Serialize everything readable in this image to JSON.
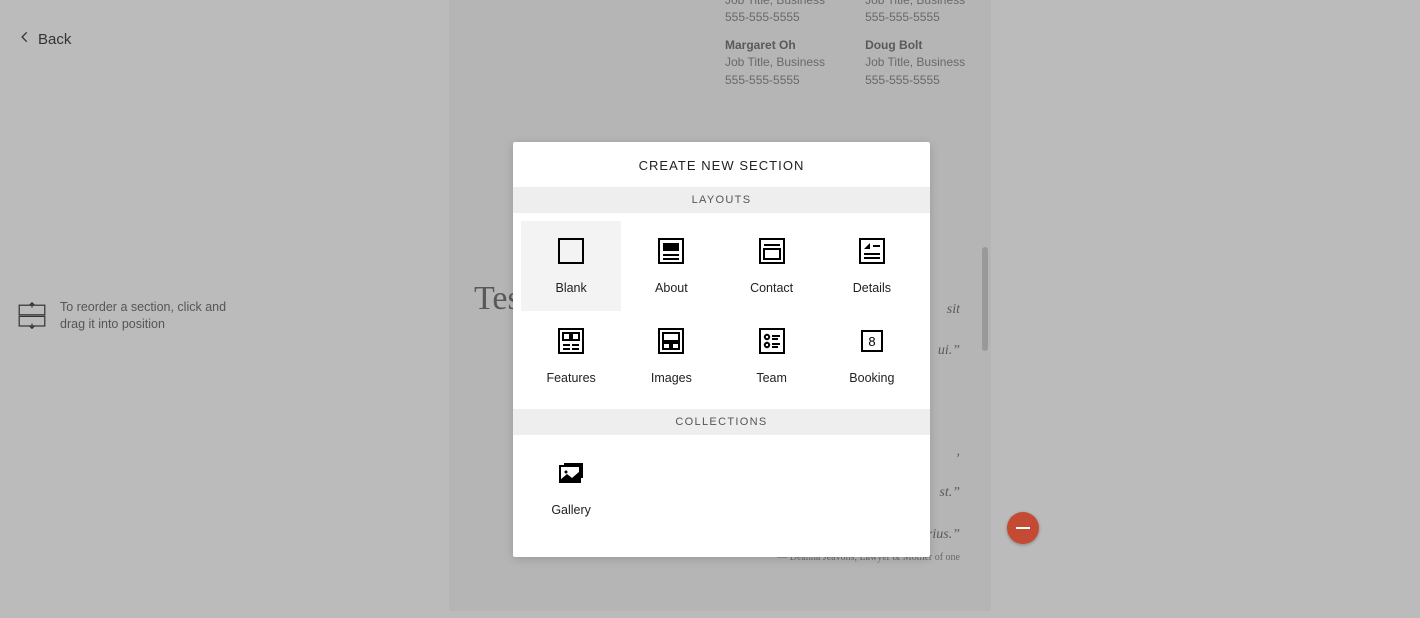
{
  "nav": {
    "back_label": "Back"
  },
  "hint_text": "To reorder a section, click and drag it into position",
  "page": {
    "contacts": [
      {
        "name": "",
        "subtitle": "Job Title, Business",
        "phone": "555-555-5555"
      },
      {
        "name": "",
        "subtitle": "Job Title, Business",
        "phone": "555-555-5555"
      },
      {
        "name": "Margaret Oh",
        "subtitle": "Job Title, Business",
        "phone": "555-555-5555"
      },
      {
        "name": "Doug Bolt",
        "subtitle": "Job Title, Business",
        "phone": "555-555-5555"
      }
    ],
    "heading_prefix": "Tes",
    "quote1_tail_a": "sit",
    "quote1_tail_b": "ui.”",
    "quote1_tail_c": ",",
    "quote1_tail_d": "st.”",
    "quote2_tail": "augue nisi, id suscipit arcu luctus varius.”",
    "attrib": "— Deanna Jeavons, Lawyer & Mother of one"
  },
  "modal": {
    "title": "CREATE NEW SECTION",
    "layouts_header": "LAYOUTS",
    "collections_header": "COLLECTIONS",
    "layouts": {
      "blank": "Blank",
      "about": "About",
      "contact": "Contact",
      "details": "Details",
      "features": "Features",
      "images": "Images",
      "team": "Team",
      "booking": "Booking"
    },
    "collections": {
      "gallery": "Gallery"
    },
    "booking_number": "8"
  }
}
